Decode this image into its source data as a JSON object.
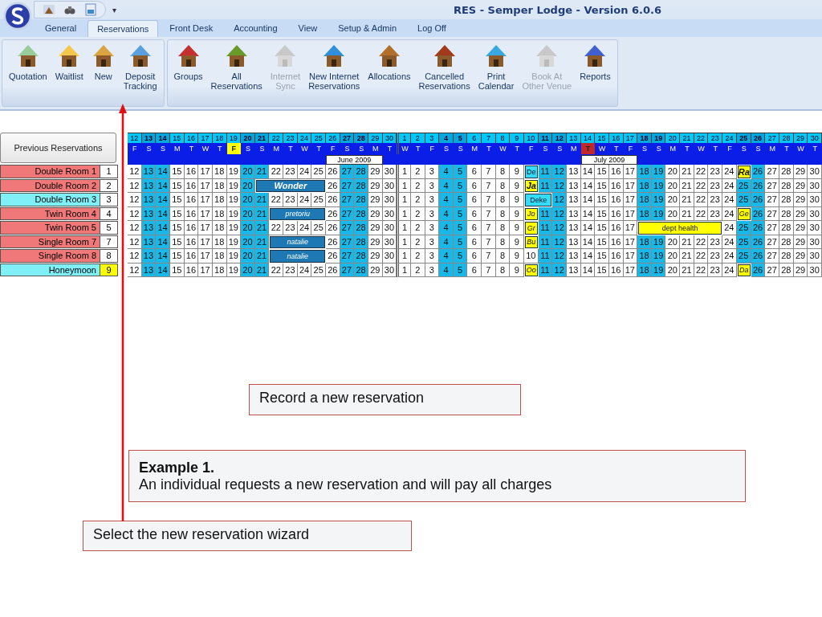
{
  "window": {
    "title": "RES - Semper Lodge - Version 6.0.6",
    "quick_menu": "▾"
  },
  "tabs": [
    {
      "label": "General",
      "selected": false
    },
    {
      "label": "Reservations",
      "selected": true
    },
    {
      "label": "Front Desk",
      "selected": false
    },
    {
      "label": "Accounting",
      "selected": false
    },
    {
      "label": "View",
      "selected": false
    },
    {
      "label": "Setup & Admin",
      "selected": false
    },
    {
      "label": "Log Off",
      "selected": false
    }
  ],
  "ribbon_groups": [
    {
      "buttons": [
        {
          "label": "Quotation",
          "disabled": false
        },
        {
          "label": "Waitlist",
          "disabled": false
        },
        {
          "label": "New",
          "disabled": false
        },
        {
          "label": "Deposit\nTracking",
          "disabled": false
        }
      ]
    },
    {
      "buttons": [
        {
          "label": "Groups",
          "disabled": false
        },
        {
          "label": "All\nReservations",
          "disabled": false
        },
        {
          "label": "Internet\nSync",
          "disabled": true
        },
        {
          "label": "New Internet\nReservations",
          "disabled": false
        },
        {
          "label": "Allocations",
          "disabled": false
        },
        {
          "label": "Cancelled\nReservations",
          "disabled": false
        },
        {
          "label": "Print\nCalendar",
          "disabled": false
        },
        {
          "label": "Book At\nOther Venue",
          "disabled": true
        },
        {
          "label": "Reports",
          "disabled": false
        }
      ]
    }
  ],
  "calendar": {
    "previous_button": "Previous Reservations",
    "days": [
      {
        "date": "12",
        "weekday": "F",
        "weekend": false
      },
      {
        "date": "13",
        "weekday": "S",
        "weekend": true
      },
      {
        "date": "14",
        "weekday": "S",
        "weekend": true
      },
      {
        "date": "15",
        "weekday": "M",
        "weekend": false
      },
      {
        "date": "16",
        "weekday": "T",
        "weekend": false
      },
      {
        "date": "17",
        "weekday": "W",
        "weekend": false
      },
      {
        "date": "18",
        "weekday": "T",
        "weekend": false
      },
      {
        "date": "19",
        "weekday": "F",
        "weekend": false,
        "color": "#ffff00"
      },
      {
        "date": "20",
        "weekday": "S",
        "weekend": true
      },
      {
        "date": "21",
        "weekday": "S",
        "weekend": true
      },
      {
        "date": "22",
        "weekday": "M",
        "weekend": false
      },
      {
        "date": "23",
        "weekday": "T",
        "weekend": false
      },
      {
        "date": "24",
        "weekday": "W",
        "weekend": false
      },
      {
        "date": "25",
        "weekday": "T",
        "weekend": false
      },
      {
        "date": "26",
        "weekday": "F",
        "weekend": false,
        "month_label": "June 2009"
      },
      {
        "date": "27",
        "weekday": "S",
        "weekend": true
      },
      {
        "date": "28",
        "weekday": "S",
        "weekend": true
      },
      {
        "date": "29",
        "weekday": "M",
        "weekend": false
      },
      {
        "date": "30",
        "weekday": "T",
        "weekend": false
      },
      {
        "date": "1",
        "weekday": "W",
        "weekend": false,
        "month_start": true
      },
      {
        "date": "2",
        "weekday": "T",
        "weekend": false
      },
      {
        "date": "3",
        "weekday": "F",
        "weekend": false
      },
      {
        "date": "4",
        "weekday": "S",
        "weekend": true
      },
      {
        "date": "5",
        "weekday": "S",
        "weekend": true
      },
      {
        "date": "6",
        "weekday": "M",
        "weekend": false
      },
      {
        "date": "7",
        "weekday": "T",
        "weekend": false
      },
      {
        "date": "8",
        "weekday": "W",
        "weekend": false
      },
      {
        "date": "9",
        "weekday": "T",
        "weekend": false
      },
      {
        "date": "10",
        "weekday": "F",
        "weekend": false
      },
      {
        "date": "11",
        "weekday": "S",
        "weekend": true
      },
      {
        "date": "12",
        "weekday": "S",
        "weekend": true
      },
      {
        "date": "13",
        "weekday": "M",
        "weekend": false
      },
      {
        "date": "14",
        "weekday": "T",
        "weekend": false,
        "color": "#c0282a",
        "month_label": "July 2009"
      },
      {
        "date": "15",
        "weekday": "W",
        "weekend": false
      },
      {
        "date": "16",
        "weekday": "T",
        "weekend": false
      },
      {
        "date": "17",
        "weekday": "F",
        "weekend": false
      },
      {
        "date": "18",
        "weekday": "S",
        "weekend": true
      },
      {
        "date": "19",
        "weekday": "S",
        "weekend": true
      },
      {
        "date": "20",
        "weekday": "M",
        "weekend": false
      },
      {
        "date": "21",
        "weekday": "T",
        "weekend": false
      },
      {
        "date": "22",
        "weekday": "W",
        "weekend": false
      },
      {
        "date": "23",
        "weekday": "T",
        "weekend": false
      },
      {
        "date": "24",
        "weekday": "F",
        "weekend": false
      },
      {
        "date": "25",
        "weekday": "S",
        "weekend": true
      },
      {
        "date": "26",
        "weekday": "S",
        "weekend": true
      },
      {
        "date": "27",
        "weekday": "M",
        "weekend": false
      },
      {
        "date": "28",
        "weekday": "T",
        "weekend": false
      },
      {
        "date": "29",
        "weekday": "W",
        "weekend": false
      },
      {
        "date": "30",
        "weekday": "T",
        "weekend": false
      }
    ],
    "rooms": [
      {
        "name": "Double Room 1",
        "number": "1",
        "color": "#f07878",
        "selected": false,
        "cells": [
          "12",
          "13",
          "14",
          "15",
          "16",
          "17",
          "18",
          "19",
          "20",
          "21",
          "22",
          "23",
          "24",
          "25",
          "26",
          "27",
          "28",
          "29",
          "30",
          "1",
          "2",
          "3",
          "4",
          "5",
          "6",
          "7",
          "8",
          "9",
          {
            "kind": "booking",
            "text": "De",
            "color": "#33ddff",
            "italic": false,
            "bold": false
          },
          "11",
          "12",
          "13",
          "14",
          "15",
          "16",
          "17",
          "18",
          "19",
          "20",
          "21",
          "22",
          "23",
          "24",
          {
            "kind": "booking",
            "text": "Ra",
            "color": "#ffff00",
            "italic": true,
            "bold": true
          },
          "26",
          "27",
          "28",
          "29",
          "30"
        ]
      },
      {
        "name": "Double Room 2",
        "number": "2",
        "color": "#f07878",
        "selected": false,
        "cells": [
          "12",
          "13",
          "14",
          "15",
          "16",
          "17",
          "18",
          "19",
          "20",
          {
            "kind": "booking",
            "text": "Wonder",
            "color": "#1e78b4",
            "italic": true,
            "bold": true
          },
          {
            "kind": "continued"
          },
          {
            "kind": "continued"
          },
          {
            "kind": "continued"
          },
          {
            "kind": "continued"
          },
          "26",
          "27",
          "28",
          "29",
          "30",
          "1",
          "2",
          "3",
          "4",
          "5",
          "6",
          "7",
          "8",
          "9",
          {
            "kind": "booking",
            "text": "Ja",
            "color": "#ffff00",
            "italic": true,
            "bold": true
          },
          "11",
          "12",
          "13",
          "14",
          "15",
          "16",
          "17",
          "18",
          "19",
          "20",
          "21",
          "22",
          "23",
          "24",
          "25",
          "26",
          "27",
          "28",
          "29",
          "30"
        ]
      },
      {
        "name": "Double Room 3",
        "number": "3",
        "color": "#80f0f8",
        "selected": false,
        "cells": [
          "12",
          "13",
          "14",
          "15",
          "16",
          "17",
          "18",
          "19",
          "20",
          "21",
          "22",
          "23",
          "24",
          "25",
          "26",
          "27",
          "28",
          "29",
          "30",
          "1",
          "2",
          "3",
          "4",
          "5",
          "6",
          "7",
          "8",
          "9",
          {
            "kind": "booking",
            "text": "Deke",
            "color": "#33ddff",
            "italic": false,
            "bold": false
          },
          {
            "kind": "continued"
          },
          "12",
          "13",
          "14",
          "15",
          "16",
          "17",
          "18",
          "19",
          "20",
          "21",
          "22",
          "23",
          "24",
          "25",
          "26",
          "27",
          "28",
          "29",
          "30"
        ]
      },
      {
        "name": "Twin Room 4",
        "number": "4",
        "color": "#f07878",
        "selected": false,
        "cells": [
          "12",
          "13",
          "14",
          "15",
          "16",
          "17",
          "18",
          "19",
          "20",
          "21",
          {
            "kind": "booking",
            "text": "pretoriu",
            "color": "#1e78b4",
            "italic": true,
            "bold": false
          },
          {
            "kind": "continued"
          },
          {
            "kind": "continued"
          },
          {
            "kind": "continued"
          },
          "26",
          "27",
          "28",
          "29",
          "30",
          "1",
          "2",
          "3",
          "4",
          "5",
          "6",
          "7",
          "8",
          "9",
          {
            "kind": "booking",
            "text": "Jo",
            "color": "#ffff00",
            "italic": true,
            "bold": false
          },
          "11",
          "12",
          "13",
          "14",
          "15",
          "16",
          "17",
          "18",
          "19",
          "20",
          "21",
          "22",
          "23",
          "24",
          {
            "kind": "booking",
            "text": "Ge",
            "color": "#ffff00",
            "italic": true,
            "bold": false
          },
          "26",
          "27",
          "28",
          "29",
          "30"
        ]
      },
      {
        "name": "Twin Room 5",
        "number": "5",
        "color": "#f07878",
        "selected": false,
        "cells": [
          "12",
          "13",
          "14",
          "15",
          "16",
          "17",
          "18",
          "19",
          "20",
          "21",
          "22",
          "23",
          "24",
          "25",
          "26",
          "27",
          "28",
          "29",
          "30",
          "1",
          "2",
          "3",
          "4",
          "5",
          "6",
          "7",
          "8",
          "9",
          {
            "kind": "booking",
            "text": "Gr",
            "color": "#ffff00",
            "italic": true,
            "bold": false
          },
          "11",
          "12",
          "13",
          "14",
          "15",
          "16",
          "17",
          {
            "kind": "booking",
            "text": "dept health",
            "color": "#ffff00",
            "italic": false,
            "bold": false
          },
          {
            "kind": "continued"
          },
          {
            "kind": "continued"
          },
          {
            "kind": "continued"
          },
          {
            "kind": "continued"
          },
          {
            "kind": "continued"
          },
          "24",
          "25",
          "26",
          "27",
          "28",
          "29",
          "30"
        ]
      },
      {
        "name": "Single Room 7",
        "number": "7",
        "color": "#f07878",
        "selected": false,
        "cells": [
          "12",
          "13",
          "14",
          "15",
          "16",
          "17",
          "18",
          "19",
          "20",
          "21",
          {
            "kind": "booking",
            "text": "natalie",
            "color": "#1e78b4",
            "italic": true,
            "bold": false
          },
          {
            "kind": "continued"
          },
          {
            "kind": "continued"
          },
          {
            "kind": "continued"
          },
          "26",
          "27",
          "28",
          "29",
          "30",
          "1",
          "2",
          "3",
          "4",
          "5",
          "6",
          "7",
          "8",
          "9",
          {
            "kind": "booking",
            "text": "Bu",
            "color": "#ffff00",
            "italic": true,
            "bold": false
          },
          "11",
          "12",
          "13",
          "14",
          "15",
          "16",
          "17",
          "18",
          "19",
          "20",
          "21",
          "22",
          "23",
          "24",
          "25",
          "26",
          "27",
          "28",
          "29",
          "30"
        ]
      },
      {
        "name": "Single  Room 8",
        "number": "8",
        "color": "#f07878",
        "selected": false,
        "cells": [
          "12",
          "13",
          "14",
          "15",
          "16",
          "17",
          "18",
          "19",
          "20",
          "21",
          {
            "kind": "booking",
            "text": "natalie",
            "color": "#1e78b4",
            "italic": true,
            "bold": false
          },
          {
            "kind": "continued"
          },
          {
            "kind": "continued"
          },
          {
            "kind": "continued"
          },
          "26",
          "27",
          "28",
          "29",
          "30",
          "1",
          "2",
          "3",
          "4",
          "5",
          "6",
          "7",
          "8",
          "9",
          "10",
          "11",
          "12",
          "13",
          "14",
          "15",
          "16",
          "17",
          "18",
          "19",
          "20",
          "21",
          "22",
          "23",
          "24",
          "25",
          "26",
          "27",
          "28",
          "29",
          "30"
        ]
      },
      {
        "name": "Honeymoon",
        "number": "9",
        "color": "#80f0f8",
        "selected": true,
        "cells": [
          "12",
          "13",
          "14",
          "15",
          "16",
          "17",
          "18",
          "19",
          "20",
          "21",
          "22",
          "23",
          "24",
          "25",
          "26",
          "27",
          "28",
          "29",
          "30",
          "1",
          "2",
          "3",
          "4",
          "5",
          "6",
          "7",
          "8",
          "9",
          {
            "kind": "booking",
            "text": "Oo",
            "color": "#ffff00",
            "italic": true,
            "bold": false
          },
          "11",
          "12",
          "13",
          "14",
          "15",
          "16",
          "17",
          "18",
          "19",
          "20",
          "21",
          "22",
          "23",
          "24",
          {
            "kind": "booking",
            "text": "Da",
            "color": "#ffff00",
            "italic": true,
            "bold": false
          },
          "26",
          "27",
          "28",
          "29",
          "30"
        ]
      }
    ]
  },
  "callouts": [
    {
      "kind": "note",
      "text": "Record a new reservation"
    },
    {
      "kind": "example",
      "heading": "Example 1.",
      "text": "An individual requests a new reservation and will pay all charges"
    },
    {
      "kind": "note",
      "text": "Select the new reservation wizard"
    }
  ]
}
